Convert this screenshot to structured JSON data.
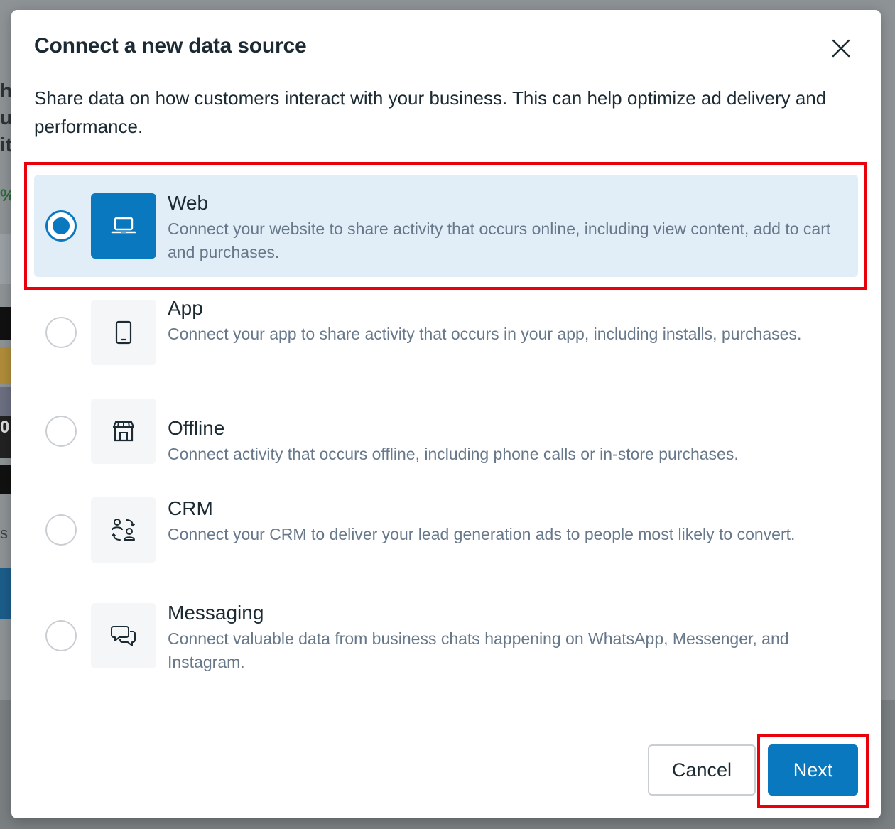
{
  "background": {
    "fragments": [
      "hi",
      "ur",
      "it",
      "%",
      "0",
      "s"
    ]
  },
  "modal": {
    "title": "Connect a new data source",
    "close_label": "×",
    "subtitle": "Share data on how customers interact with your business. This can help optimize ad delivery and performance.",
    "options": [
      {
        "icon": "laptop-icon",
        "title": "Web",
        "description": "Connect your website to share activity that occurs online, including view content, add to cart and purchases.",
        "selected": true
      },
      {
        "icon": "phone-icon",
        "title": "App",
        "description": "Connect your app to share activity that occurs in your app, including installs, purchases.",
        "selected": false
      },
      {
        "icon": "store-icon",
        "title": "Offline",
        "description": "Connect activity that occurs offline, including phone calls or in-store purchases.",
        "selected": false
      },
      {
        "icon": "people-sync-icon",
        "title": "CRM",
        "description": "Connect your CRM to deliver your lead generation ads to people most likely to convert.",
        "selected": false
      },
      {
        "icon": "chat-bubbles-icon",
        "title": "Messaging",
        "description": "Connect valuable data from business chats happening on WhatsApp, Messenger, and Instagram.",
        "selected": false
      }
    ],
    "buttons": {
      "cancel": "Cancel",
      "next": "Next"
    }
  },
  "colors": {
    "accent": "#0a78be",
    "selected_bg": "#e1edf7",
    "highlight": "#e8000b"
  }
}
